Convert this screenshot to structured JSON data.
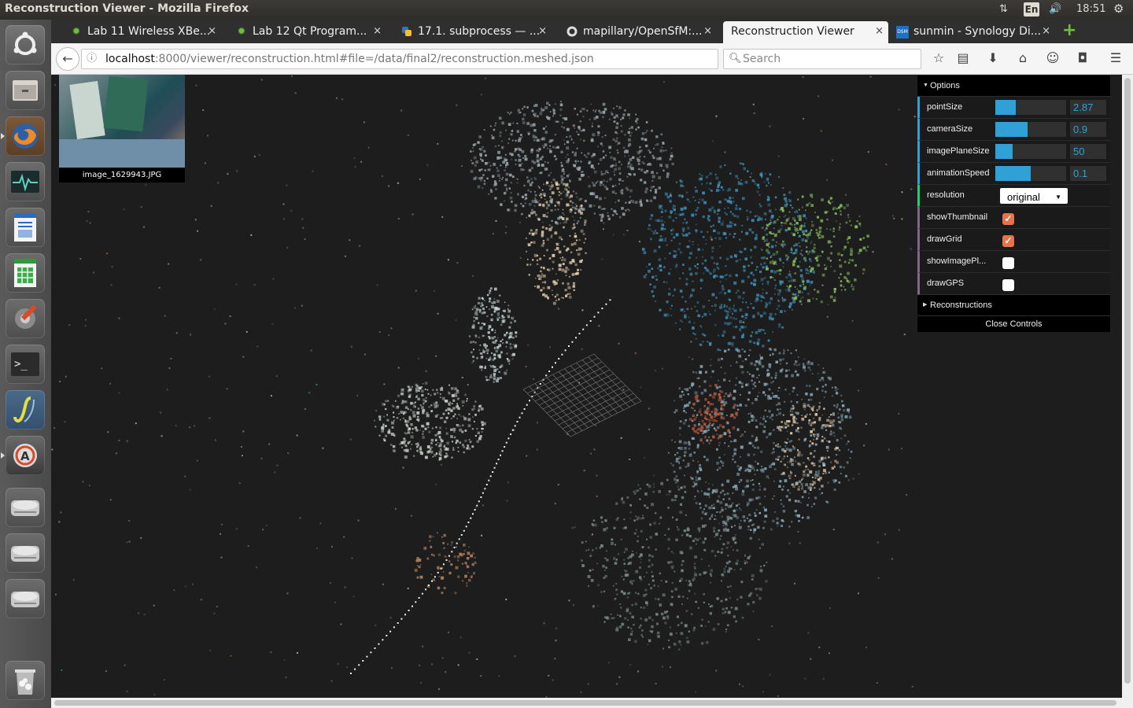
{
  "window": {
    "title": "Reconstruction Viewer - Mozilla Firefox"
  },
  "topbar": {
    "keyboard": "En",
    "time": "18:51"
  },
  "tabs": [
    {
      "label": "Lab 11 Wireless XBe...",
      "icon": "gear-icon",
      "active": false
    },
    {
      "label": "Lab 12 Qt Program...",
      "icon": "gear-icon",
      "active": false
    },
    {
      "label": "17.1. subprocess — ...",
      "icon": "python-icon",
      "active": false
    },
    {
      "label": "mapillary/OpenSfM:...",
      "icon": "github-icon",
      "active": false
    },
    {
      "label": "Reconstruction Viewer",
      "icon": "",
      "active": true
    },
    {
      "label": "sunmin - Synology Di...",
      "icon": "dsm-icon",
      "active": false
    }
  ],
  "tab_close": "×",
  "dsm_badge": "DSM",
  "url": {
    "host": "localhost",
    "rest": ":8000/viewer/reconstruction.html#file=/data/final2/reconstruction.meshed.json"
  },
  "search": {
    "placeholder": "Search"
  },
  "thumbnail": {
    "caption": "image_1629943.JPG"
  },
  "gui": {
    "options_label": "Options",
    "sliders": [
      {
        "name": "pointSize",
        "value": "2.87",
        "fill_pct": 29
      },
      {
        "name": "cameraSize",
        "value": "0.9",
        "fill_pct": 45
      },
      {
        "name": "imagePlaneSize",
        "value": "50",
        "fill_pct": 24
      },
      {
        "name": "animationSpeed",
        "value": "0.1",
        "fill_pct": 50
      }
    ],
    "resolution": {
      "name": "resolution",
      "value": "original"
    },
    "checkboxes": [
      {
        "name": "showThumbnail",
        "checked": true
      },
      {
        "name": "drawGrid",
        "checked": true
      },
      {
        "name": "showImagePl...",
        "checked": false
      },
      {
        "name": "drawGPS",
        "checked": false
      }
    ],
    "reconstructions_label": "Reconstructions",
    "close_label": "Close Controls"
  },
  "colors": {
    "accent": "#2fa1d6",
    "checkbox_on": "#e8734a",
    "viewer_bg": "#1d1d1d"
  }
}
